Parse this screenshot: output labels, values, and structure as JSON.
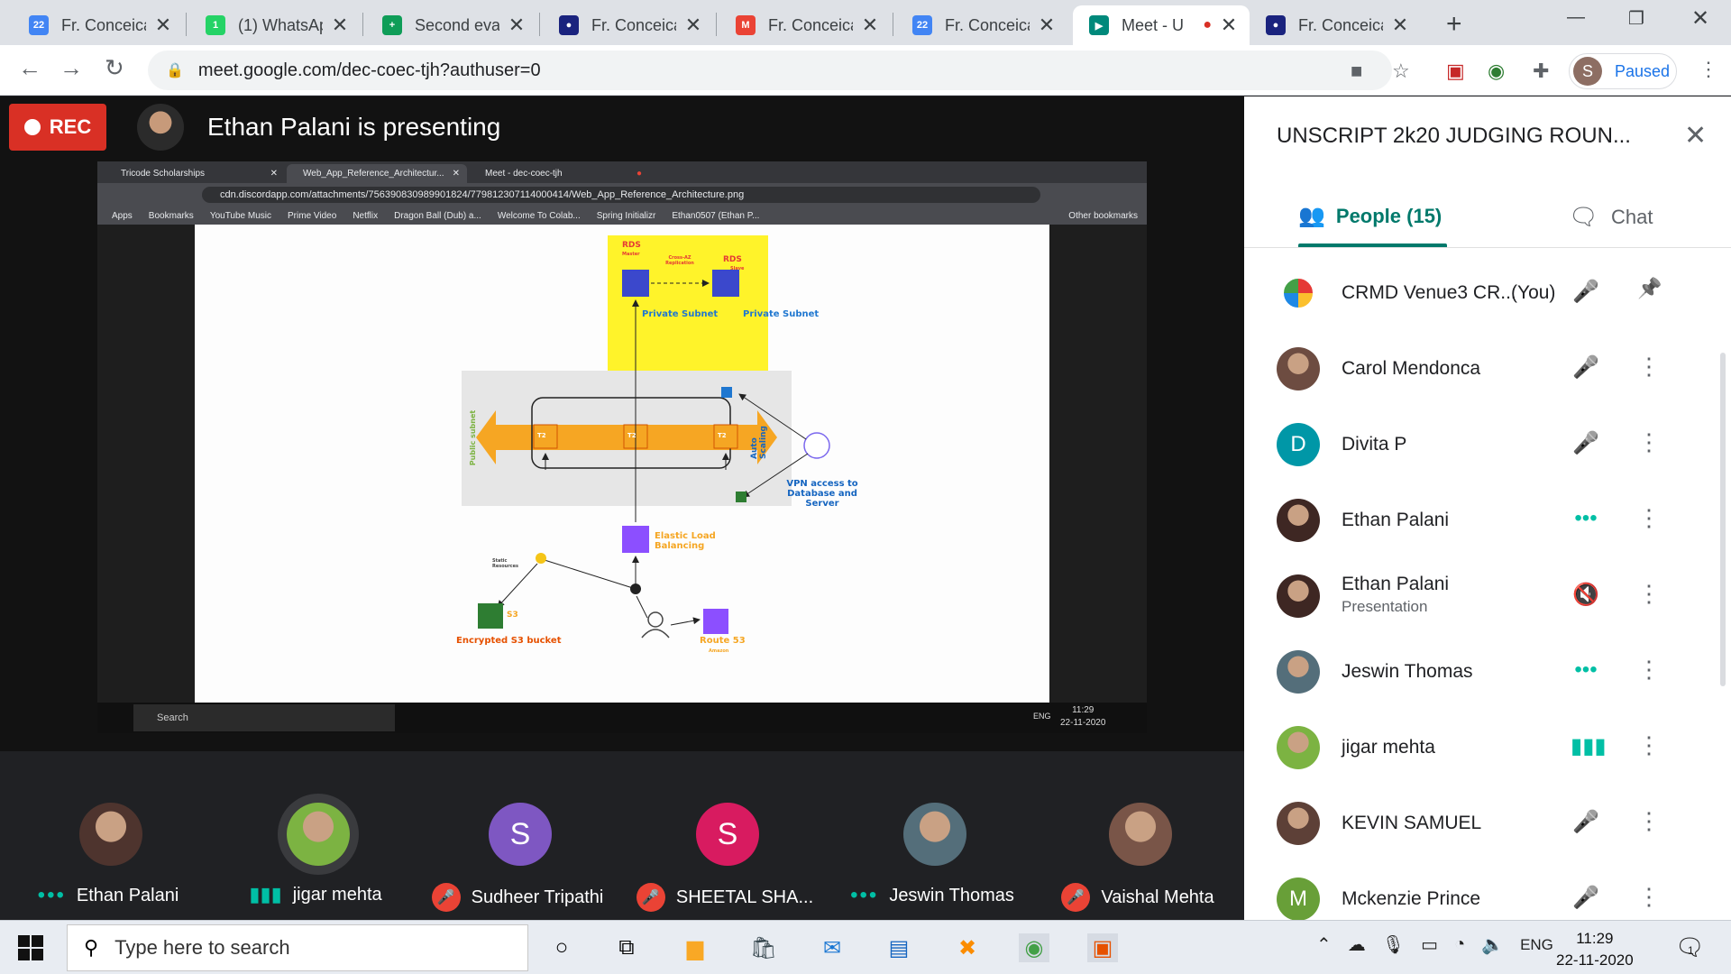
{
  "browser": {
    "tabs": [
      {
        "title": "Fr. Conceicao",
        "fav": "google-calendar-icon",
        "color": "#4285f4",
        "glyph": "22"
      },
      {
        "title": "(1) WhatsApp",
        "fav": "whatsapp-icon",
        "color": "#25d366",
        "glyph": "1"
      },
      {
        "title": "Second evaluation",
        "fav": "google-sheets-icon",
        "color": "#0f9d58",
        "glyph": "+"
      },
      {
        "title": "Fr. Conceicao",
        "fav": "college-crest-icon",
        "color": "#1a237e",
        "glyph": "●"
      },
      {
        "title": "Fr. Conceicao",
        "fav": "gmail-icon",
        "color": "#ea4335",
        "glyph": "M"
      },
      {
        "title": "Fr. Conceicao",
        "fav": "google-calendar-icon",
        "color": "#4285f4",
        "glyph": "22"
      },
      {
        "title": "Meet - U",
        "fav": "google-meet-icon",
        "color": "#00897b",
        "glyph": "▶"
      },
      {
        "title": "Fr. Conceicao",
        "fav": "college-crest-icon",
        "color": "#1a237e",
        "glyph": "●"
      }
    ],
    "url": "meet.google.com/dec-coec-tjh?authuser=0",
    "profile_initial": "S",
    "profile_label": "Paused"
  },
  "meet": {
    "rec_label": "REC",
    "presenting": "Ethan Palani is presenting",
    "panel_title": "UNSCRIPT 2k20 JUDGING ROUN...",
    "tab_people": "People (15)",
    "tab_chat": "Chat",
    "participants_panel": [
      {
        "name": "CRMD Venue3 CR...",
        "suffix": "(You)",
        "sub": "",
        "status": "mic-off-icon",
        "action": "pin-icon",
        "avatar": "logo",
        "color": "#ffffff",
        "initial": ""
      },
      {
        "name": "Carol Mendonca",
        "suffix": "",
        "sub": "",
        "status": "mic-off-icon",
        "action": "more-icon",
        "avatar": "photo",
        "color": "#6d4c41",
        "initial": ""
      },
      {
        "name": "Divita P",
        "suffix": "",
        "sub": "",
        "status": "mic-off-icon",
        "action": "more-icon",
        "avatar": "initial",
        "color": "#0097a7",
        "initial": "D"
      },
      {
        "name": "Ethan Palani",
        "suffix": "",
        "sub": "",
        "status": "speaking-dots-icon",
        "action": "more-icon",
        "avatar": "photo",
        "color": "#3e2723",
        "initial": ""
      },
      {
        "name": "Ethan Palani",
        "suffix": "",
        "sub": "Presentation",
        "status": "volume-off-icon",
        "action": "more-icon",
        "avatar": "photo",
        "color": "#3e2723",
        "initial": ""
      },
      {
        "name": "Jeswin Thomas",
        "suffix": "",
        "sub": "",
        "status": "speaking-dots-icon",
        "action": "more-icon",
        "avatar": "photo",
        "color": "#546e7a",
        "initial": ""
      },
      {
        "name": "jigar mehta",
        "suffix": "",
        "sub": "",
        "status": "audio-wave-icon",
        "action": "more-icon",
        "avatar": "photo",
        "color": "#7cb342",
        "initial": ""
      },
      {
        "name": "KEVIN SAMUEL",
        "suffix": "",
        "sub": "",
        "status": "mic-off-icon",
        "action": "more-icon",
        "avatar": "photo",
        "color": "#5d4037",
        "initial": ""
      },
      {
        "name": "Mckenzie Prince",
        "suffix": "",
        "sub": "",
        "status": "mic-off-icon",
        "action": "more-icon",
        "avatar": "initial",
        "color": "#689f38",
        "initial": "M"
      }
    ],
    "strip": [
      {
        "name": "Ethan Palani",
        "status": "speaking-dots-icon",
        "avatar": "photo",
        "color": "#4e342e",
        "initial": ""
      },
      {
        "name": "jigar mehta",
        "status": "audio-wave-icon",
        "avatar": "photo",
        "color": "#7cb342",
        "initial": ""
      },
      {
        "name": "Sudheer Tripathi",
        "status": "mic-off-icon",
        "avatar": "initial",
        "color": "#7e57c2",
        "initial": "S"
      },
      {
        "name": "SHEETAL SHA...",
        "status": "mic-off-icon",
        "avatar": "initial",
        "color": "#d81b60",
        "initial": "S"
      },
      {
        "name": "Jeswin Thomas",
        "status": "speaking-dots-icon",
        "avatar": "photo",
        "color": "#546e7a",
        "initial": ""
      },
      {
        "name": "Vaishal Mehta",
        "status": "mic-off-icon",
        "avatar": "photo",
        "color": "#795548",
        "initial": ""
      }
    ]
  },
  "shared": {
    "tabs": [
      "Tricode Scholarships",
      "Web_App_Reference_Architectur...",
      "Meet - dec-coec-tjh"
    ],
    "url": "cdn.discordapp.com/attachments/756390830989901824/779812307114000414/Web_App_Reference_Architecture.png",
    "bookmarks": [
      "Apps",
      "Bookmarks",
      "YouTube Music",
      "Prime Video",
      "Netflix",
      "Dragon Ball (Dub) a...",
      "Welcome To Colab...",
      "Spring Initializr",
      "Ethan0507 (Ethan P...",
      "Other bookmarks"
    ],
    "taskbar_search": "Search",
    "time": "11:29",
    "date": "22-11-2020",
    "lang": "ENG",
    "diagram": {
      "rds_master": "RDS",
      "rds_master_sub": "Master",
      "rds_slave": "RDS",
      "rds_slave_sub": "Slave",
      "replication": "Cross-AZ Replication",
      "private_subnet_1": "Private Subnet",
      "private_subnet_2": "Private Subnet",
      "public_subnet": "Public subnet",
      "auto_scaling": "Auto Scaling",
      "t2": "T2",
      "vpn": "VPN access to Database and Server",
      "elb": "Elastic Load Balancing",
      "static": "Static Resources",
      "s3": "S3",
      "s3_bucket": "Encrypted S3 bucket",
      "route53": "Route 53",
      "route53_sub": "Amazon"
    }
  },
  "taskbar": {
    "search_placeholder": "Type here to search",
    "lang": "ENG",
    "time": "11:29",
    "date": "22-11-2020",
    "notif_count": "1"
  }
}
